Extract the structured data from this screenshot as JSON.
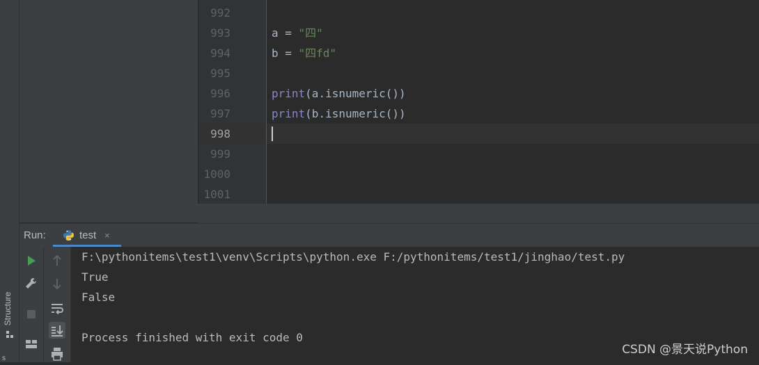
{
  "sidebar": {
    "structure_label": "Structure",
    "bottom_label": "s"
  },
  "editor": {
    "line_numbers": [
      "992",
      "993",
      "994",
      "995",
      "996",
      "997",
      "998",
      "999",
      "1000",
      "1001"
    ],
    "current_line": "998",
    "lines": [
      {
        "text": ""
      },
      {
        "text": "a = \"四\""
      },
      {
        "text": "b = \"四fd\""
      },
      {
        "text": ""
      },
      {
        "text": "print(a.isnumeric())"
      },
      {
        "text": "print(b.isnumeric())"
      },
      {
        "text": ""
      },
      {
        "text": ""
      },
      {
        "text": ""
      },
      {
        "text": ""
      }
    ]
  },
  "run_panel": {
    "title": "Run:",
    "tab_label": "test",
    "tab_close": "×",
    "console": [
      "F:\\pythonitems\\test1\\venv\\Scripts\\python.exe F:/pythonitems/test1/jinghao/test.py",
      "True",
      "False",
      "",
      "Process finished with exit code 0"
    ]
  },
  "watermark": "CSDN @景天说Python",
  "colors": {
    "editor_bg": "#2b2b2b",
    "panel_bg": "#3c3f41",
    "builtin": "#8888c6",
    "string": "#6a8759",
    "run_green": "#499c54",
    "tab_underline": "#4a88c7"
  }
}
